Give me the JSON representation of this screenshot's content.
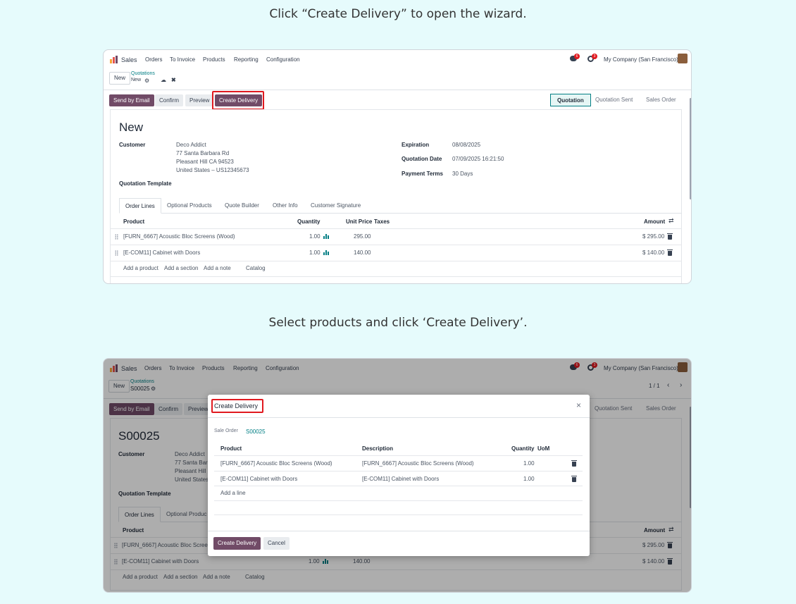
{
  "captions": {
    "step1": "Click “Create Delivery” to open the wizard.",
    "step2": "Select products and click ‘Create Delivery’."
  },
  "colors": {
    "brand": "#714b67",
    "link": "#017e84",
    "highlight": "#e0191f",
    "page_bg": "#e6fbfc"
  },
  "nav": {
    "app": "Sales",
    "items": [
      "Orders",
      "To Invoice",
      "Products",
      "Reporting",
      "Configuration"
    ],
    "company": "My Company (San Francisco)",
    "chat_badge": "6",
    "activity_badge": "3",
    "icons": [
      "chat-icon",
      "clock-icon",
      "avatar"
    ]
  },
  "shot1": {
    "new_button": "New",
    "breadcrumb_parent": "Quotations",
    "record": "New",
    "actions": {
      "send_email": "Send by Email",
      "confirm": "Confirm",
      "preview": "Preview",
      "create_delivery": "Create Delivery"
    },
    "stages": [
      "Quotation",
      "Quotation Sent",
      "Sales Order"
    ],
    "active_stage": "Quotation",
    "title": "New",
    "customer_label": "Customer",
    "customer": [
      "Deco Addict",
      "77 Santa Barbara Rd",
      "Pleasant Hill CA 94523",
      "United States – US12345673"
    ],
    "expiration_label": "Expiration",
    "expiration": "08/08/2025",
    "quotation_date_label": "Quotation Date",
    "quotation_date": "07/09/2025 16:21:50",
    "payment_terms_label": "Payment Terms",
    "payment_terms": "30 Days",
    "template_label": "Quotation Template",
    "tabs": [
      "Order Lines",
      "Optional Products",
      "Quote Builder",
      "Other Info",
      "Customer Signature"
    ],
    "columns": {
      "product": "Product",
      "quantity": "Quantity",
      "unit_price": "Unit Price",
      "taxes": "Taxes",
      "amount": "Amount"
    },
    "lines": [
      {
        "product": "[FURN_6667] Acoustic Bloc Screens (Wood)",
        "quantity": "1.00",
        "unit_price": "295.00",
        "amount": "$ 295.00"
      },
      {
        "product": "[E-COM11] Cabinet with Doors",
        "quantity": "1.00",
        "unit_price": "140.00",
        "amount": "$ 140.00"
      }
    ],
    "add_links": [
      "Add a product",
      "Add a section",
      "Add a note",
      "Catalog"
    ]
  },
  "shot2": {
    "new_button": "New",
    "breadcrumb_parent": "Quotations",
    "record": "S00025",
    "pager": "1 / 1",
    "actions": {
      "send_email": "Send by Email",
      "confirm": "Confirm",
      "preview": "Preview"
    },
    "stages": [
      "Quotation Sent",
      "Sales Order"
    ],
    "title": "S00025",
    "customer_label": "Customer",
    "customer": [
      "Deco Addict",
      "77 Santa Barba",
      "Pleasant Hill",
      "United States"
    ],
    "template_label": "Quotation Template",
    "tabs": [
      "Order Lines",
      "Optional Produc"
    ],
    "columns": {
      "product": "Product",
      "amount": "Amount"
    },
    "lines": [
      {
        "product": "[FURN_6667] Acoustic Bloc Screens",
        "quantity": "",
        "unit_price": "",
        "amount": "$ 295.00"
      },
      {
        "product": "[E-COM11] Cabinet with Doors",
        "quantity": "1.00",
        "unit_price": "140.00",
        "amount": "$ 140.00"
      }
    ],
    "add_links": [
      "Add a product",
      "Add a section",
      "Add a note",
      "Catalog"
    ]
  },
  "dialog": {
    "title": "Create Delivery",
    "sale_order_label": "Sale Order",
    "sale_order": "S00025",
    "columns": {
      "product": "Product",
      "description": "Description",
      "quantity": "Quantity",
      "uom": "UoM"
    },
    "lines": [
      {
        "product": "[FURN_6667] Acoustic Bloc Screens (Wood)",
        "description": "[FURN_6667] Acoustic Bloc Screens (Wood)",
        "quantity": "1.00"
      },
      {
        "product": "[E-COM11] Cabinet with Doors",
        "description": "[E-COM11] Cabinet with Doors",
        "quantity": "1.00"
      }
    ],
    "add_line": "Add a line",
    "confirm_button": "Create Delivery",
    "cancel_button": "Cancel"
  }
}
